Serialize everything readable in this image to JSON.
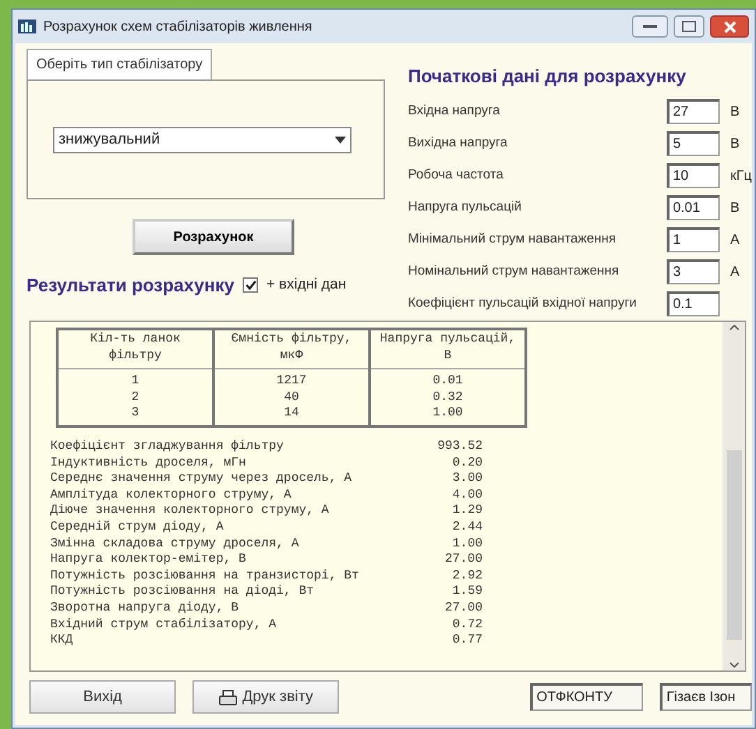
{
  "window": {
    "title": "Розрахунок схем стабілізаторів живлення"
  },
  "type_tab": {
    "label": "Оберіть тип стабілізатору",
    "selected": true
  },
  "stabilizer_type": {
    "value": "знижувальний"
  },
  "calculate_button": "Розрахунок",
  "inputs_heading": "Початкові дані для розрахунку",
  "inputs": [
    {
      "label": "Вхідна напруга",
      "value": "27",
      "unit": "В"
    },
    {
      "label": "Вихідна напруга",
      "value": "5",
      "unit": "В"
    },
    {
      "label": "Робоча частота",
      "value": "10",
      "unit": "кГц"
    },
    {
      "label": "Напруга пульсацій",
      "value": "0.01",
      "unit": "В"
    },
    {
      "label": "Мінімальний струм навантаження",
      "value": "1",
      "unit": "А"
    },
    {
      "label": "Номінальний струм навантаження",
      "value": "3",
      "unit": "А"
    },
    {
      "label": "Коефіцієнт пульсацій вхідної напруги",
      "value": "0.1"
    }
  ],
  "results_heading": "Результати розрахунку",
  "include_inputs": {
    "label": "+ вхідні дан",
    "checked": true
  },
  "filter_table": {
    "columns": [
      "Кіл-ть ланок фільтру",
      "Ємність фільтру, мкФ",
      "Напруга пульсацій, В"
    ],
    "rows": [
      [
        "1",
        "1217",
        "0.01"
      ],
      [
        "2",
        "40",
        "0.32"
      ],
      [
        "3",
        "14",
        "1.00"
      ]
    ]
  },
  "results": [
    {
      "label": "Коефіцієнт згладжування фільтру",
      "value": "993.52"
    },
    {
      "label": "Індуктивність дроселя, мГн",
      "value": "0.20"
    },
    {
      "label": "Середнє значення струму через дросель, А",
      "value": "3.00"
    },
    {
      "label": "Амплітуда колекторного струму, А",
      "value": "4.00"
    },
    {
      "label": "Діюче значення колекторного струму, А",
      "value": "1.29"
    },
    {
      "label": "Середній струм діоду, А",
      "value": "2.44"
    },
    {
      "label": "Змінна складова струму дроселя, А",
      "value": "1.00"
    },
    {
      "label": "Напруга колектор-емітер, В",
      "value": "27.00"
    },
    {
      "label": "Потужність розсіювання на транзисторі, Вт",
      "value": "2.92"
    },
    {
      "label": "Потужність розсіювання на діоді, Вт",
      "value": "1.59"
    },
    {
      "label": "Зворотна напруга діоду, В",
      "value": "27.00"
    },
    {
      "label": "Вхідний струм стабілізатору, А",
      "value": "0.72"
    },
    {
      "label": "ККД",
      "value": "0.77"
    }
  ],
  "buttons": [
    {
      "label": "Вихід",
      "kind": "plain"
    },
    {
      "label": "Друк звіту",
      "kind": "print"
    }
  ],
  "status_bar": [
    "ОТФКОНТУ",
    "Гізаєв Ізон"
  ]
}
